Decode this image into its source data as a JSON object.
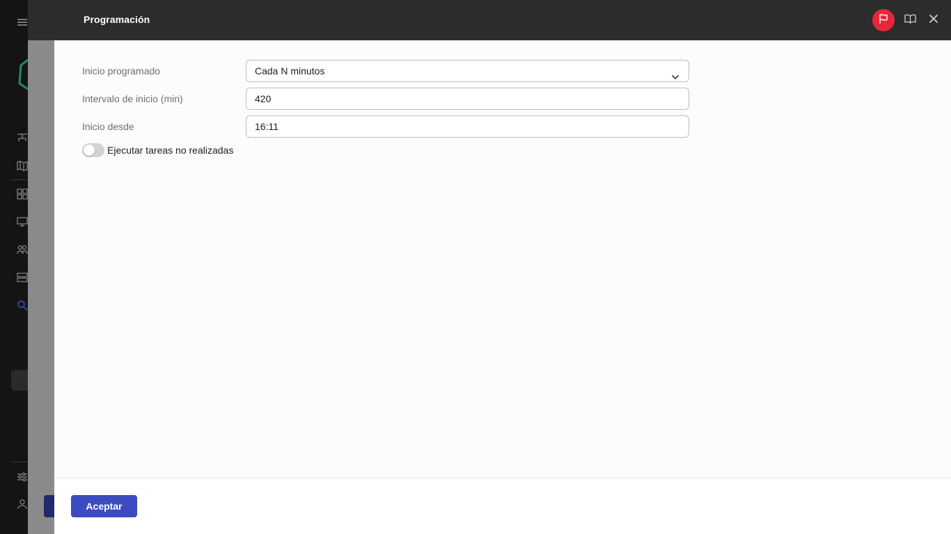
{
  "panel": {
    "title": "Programación",
    "header_icons": [
      "flag-icon",
      "book-icon",
      "close-icon"
    ],
    "accent_color": "#e8263a"
  },
  "form": {
    "scheduled_start": {
      "label": "Inicio programado",
      "value": "Cada N minutos"
    },
    "start_interval": {
      "label": "Intervalo de inicio (min)",
      "value": "420"
    },
    "start_from": {
      "label": "Inicio desde",
      "value": "16:11"
    },
    "run_missed_tasks": {
      "label": "Ejecutar tareas no realizadas",
      "enabled": false
    }
  },
  "footer": {
    "accept_label": "Aceptar",
    "accept_color": "#3c4bbf"
  },
  "background_nav": {
    "icons": [
      "menu-icon",
      "network-icon",
      "map-icon",
      "dashboard-icon",
      "monitor-icon",
      "users-icon",
      "storage-icon",
      "search-icon",
      "settings-sliders-icon",
      "user-icon"
    ]
  }
}
